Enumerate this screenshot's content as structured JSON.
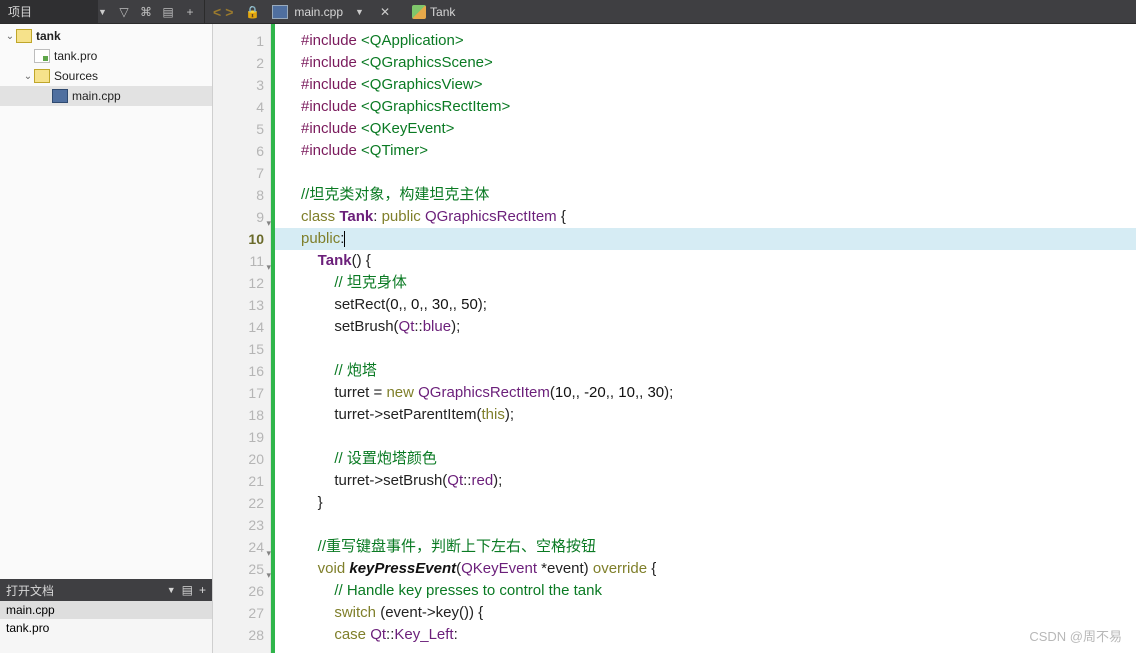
{
  "toolbar": {
    "project_label": "项目",
    "tab_file": "main.cpp",
    "context_label": "Tank"
  },
  "tree": {
    "project": "tank",
    "pro_file": "tank.pro",
    "sources": "Sources",
    "main_cpp": "main.cpp"
  },
  "open_docs": {
    "title": "打开文档",
    "items": [
      "main.cpp",
      "tank.pro"
    ]
  },
  "editor": {
    "current_line": 10,
    "fold_lines": [
      9,
      11,
      24,
      25
    ],
    "lines": [
      {
        "n": 1,
        "seg": [
          [
            "inc",
            "#include "
          ],
          [
            "str",
            "<QApplication>"
          ]
        ]
      },
      {
        "n": 2,
        "seg": [
          [
            "inc",
            "#include "
          ],
          [
            "str",
            "<QGraphicsScene>"
          ]
        ]
      },
      {
        "n": 3,
        "seg": [
          [
            "inc",
            "#include "
          ],
          [
            "str",
            "<QGraphicsView>"
          ]
        ]
      },
      {
        "n": 4,
        "seg": [
          [
            "inc",
            "#include "
          ],
          [
            "str",
            "<QGraphicsRectItem>"
          ]
        ]
      },
      {
        "n": 5,
        "seg": [
          [
            "inc",
            "#include "
          ],
          [
            "str",
            "<QKeyEvent>"
          ]
        ]
      },
      {
        "n": 6,
        "seg": [
          [
            "inc",
            "#include "
          ],
          [
            "str",
            "<QTimer>"
          ]
        ]
      },
      {
        "n": 7,
        "seg": []
      },
      {
        "n": 8,
        "seg": [
          [
            "cmt",
            "//坦克类对象，构建坦克主体"
          ]
        ]
      },
      {
        "n": 9,
        "seg": [
          [
            "kw",
            "class "
          ],
          [
            "type bld",
            "Tank"
          ],
          [
            "",
            ": "
          ],
          [
            "kw",
            "public "
          ],
          [
            "type",
            "QGraphicsRectItem"
          ],
          [
            "",
            " {"
          ]
        ]
      },
      {
        "n": 10,
        "hl": true,
        "seg": [
          [
            "kw",
            "public"
          ],
          [
            "",
            ":"
          ],
          [
            "caret",
            ""
          ]
        ]
      },
      {
        "n": 11,
        "seg": [
          [
            "",
            "    "
          ],
          [
            "type bld",
            "Tank"
          ],
          [
            "",
            "() {"
          ]
        ]
      },
      {
        "n": 12,
        "seg": [
          [
            "",
            "        "
          ],
          [
            "cmt",
            "// 坦克身体"
          ]
        ]
      },
      {
        "n": 13,
        "seg": [
          [
            "",
            "        setRect("
          ],
          [
            "num",
            "0"
          ],
          [
            "",
            ","
          ],
          [
            "",
            ", "
          ],
          [
            "num",
            "0"
          ],
          [
            "",
            ","
          ],
          [
            "",
            ", "
          ],
          [
            "num",
            "30"
          ],
          [
            "",
            ","
          ],
          [
            "",
            ", "
          ],
          [
            "num",
            "50"
          ],
          [
            "",
            ");"
          ]
        ]
      },
      {
        "n": 14,
        "seg": [
          [
            "",
            "        setBrush("
          ],
          [
            "type",
            "Qt"
          ],
          [
            "",
            "::"
          ],
          [
            "enum",
            "blue"
          ],
          [
            "",
            ");"
          ]
        ]
      },
      {
        "n": 15,
        "seg": []
      },
      {
        "n": 16,
        "seg": [
          [
            "",
            "        "
          ],
          [
            "cmt",
            "// 炮塔"
          ]
        ]
      },
      {
        "n": 17,
        "seg": [
          [
            "",
            "        turret = "
          ],
          [
            "kw",
            "new "
          ],
          [
            "type",
            "QGraphicsRectItem"
          ],
          [
            "",
            "("
          ],
          [
            "num",
            "10"
          ],
          [
            "",
            ","
          ],
          [
            "",
            ", "
          ],
          [
            "num",
            "-20"
          ],
          [
            "",
            ","
          ],
          [
            "",
            ", "
          ],
          [
            "num",
            "10"
          ],
          [
            "",
            ","
          ],
          [
            "",
            ", "
          ],
          [
            "num",
            "30"
          ],
          [
            "",
            ");"
          ]
        ]
      },
      {
        "n": 18,
        "seg": [
          [
            "",
            "        turret->setParentItem("
          ],
          [
            "kw",
            "this"
          ],
          [
            "",
            ");"
          ]
        ]
      },
      {
        "n": 19,
        "seg": []
      },
      {
        "n": 20,
        "seg": [
          [
            "",
            "        "
          ],
          [
            "cmt",
            "// 设置炮塔颜色"
          ]
        ]
      },
      {
        "n": 21,
        "seg": [
          [
            "",
            "        turret->setBrush("
          ],
          [
            "type",
            "Qt"
          ],
          [
            "",
            "::"
          ],
          [
            "enum",
            "red"
          ],
          [
            "",
            ");"
          ]
        ]
      },
      {
        "n": 22,
        "seg": [
          [
            "",
            "    }"
          ]
        ]
      },
      {
        "n": 23,
        "seg": []
      },
      {
        "n": 24,
        "seg": [
          [
            "",
            "    "
          ],
          [
            "cmt",
            "//重写键盘事件，判断上下左右、空格按钮"
          ]
        ]
      },
      {
        "n": 25,
        "seg": [
          [
            "",
            "    "
          ],
          [
            "kw",
            "void "
          ],
          [
            "fn ital",
            "keyPressEvent"
          ],
          [
            "",
            "("
          ],
          [
            "type",
            "QKeyEvent"
          ],
          [
            "",
            " *event) "
          ],
          [
            "kw",
            "override"
          ],
          [
            "",
            " {"
          ]
        ]
      },
      {
        "n": 26,
        "seg": [
          [
            "",
            "        "
          ],
          [
            "cmt",
            "// Handle key presses to control the tank"
          ]
        ]
      },
      {
        "n": 27,
        "seg": [
          [
            "",
            "        "
          ],
          [
            "kw",
            "switch"
          ],
          [
            "",
            " (event->key()) {"
          ]
        ]
      },
      {
        "n": 28,
        "seg": [
          [
            "",
            "        "
          ],
          [
            "kw",
            "case "
          ],
          [
            "type",
            "Qt"
          ],
          [
            "",
            "::"
          ],
          [
            "enum",
            "Key_Left"
          ],
          [
            "",
            ":"
          ]
        ]
      }
    ]
  },
  "watermark": "CSDN @周不易"
}
